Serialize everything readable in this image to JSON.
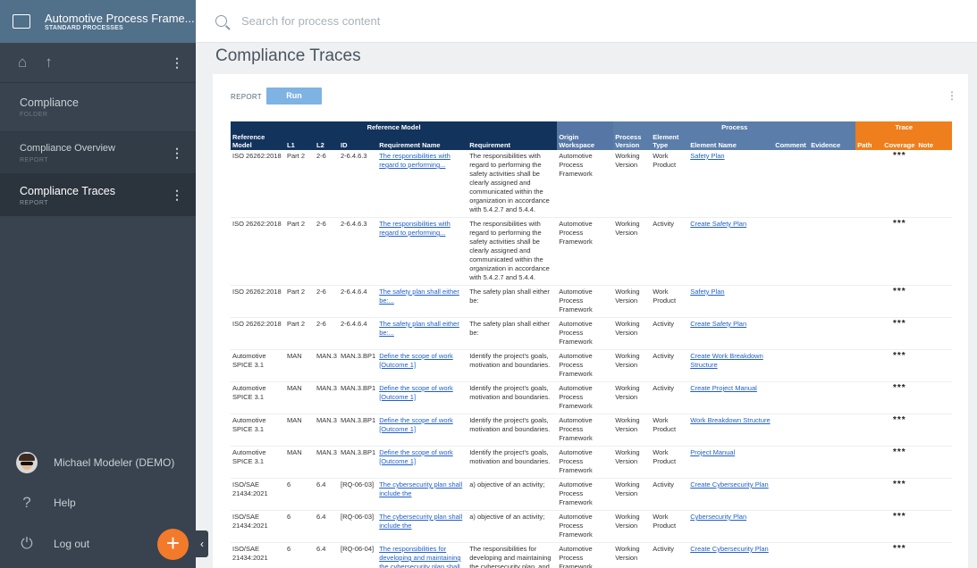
{
  "project": {
    "title": "Automotive Process Frame...",
    "subtitle": "STANDARD PROCESSES"
  },
  "sidebar": {
    "folder": {
      "title": "Compliance",
      "type": "FOLDER"
    },
    "items": [
      {
        "title": "Compliance Overview",
        "type": "REPORT"
      },
      {
        "title": "Compliance Traces",
        "type": "REPORT"
      }
    ],
    "user": "Michael Modeler (DEMO)",
    "help": "Help",
    "logout": "Log out"
  },
  "search": {
    "placeholder": "Search for process content"
  },
  "page": {
    "title": "Compliance Traces"
  },
  "report": {
    "label": "REPORT",
    "run": "Run"
  },
  "table": {
    "groups": {
      "reference_model": "Reference Model",
      "process": "Process",
      "trace": "Trace"
    },
    "headers": {
      "ref_model": "Reference Model",
      "l1": "L1",
      "l2": "L2",
      "id": "ID",
      "req_name": "Requirement Name",
      "req": "Requirement",
      "origin": "Origin Workspace",
      "version": "Process Version",
      "etype": "Element Type",
      "ename": "Element Name",
      "comment": "Comment",
      "evidence": "Evidence",
      "path": "Path",
      "coverage": "Coverage",
      "note": "Note"
    },
    "rows": [
      {
        "ref": "ISO 26262:2018",
        "l1": "Part 2",
        "l2": "2-6",
        "id": "2-6.4.6.3",
        "req_name": "The responsibilities with regard to performing...",
        "req": "The responsibilities with regard to performing the safety activities shall be clearly assigned and communicated within the organization in accordance with 5.4.2.7 and 5.4.4.",
        "origin": "Automotive Process Framework",
        "version": "Working Version",
        "etype": "Work Product",
        "ename": "Safety Plan",
        "cov": "***"
      },
      {
        "ref": "ISO 26262:2018",
        "l1": "Part 2",
        "l2": "2-6",
        "id": "2-6.4.6.3",
        "req_name": "The responsibilities with regard to performing...",
        "req": "The responsibilities with regard to performing the safety activities shall be clearly assigned and communicated within the organization in accordance with 5.4.2.7 and 5.4.4.",
        "origin": "Automotive Process Framework",
        "version": "Working Version",
        "etype": "Activity",
        "ename": "Create Safety Plan",
        "cov": "***"
      },
      {
        "ref": "ISO 26262:2018",
        "l1": "Part 2",
        "l2": "2-6",
        "id": "2-6.4.6.4",
        "req_name": "The safety plan shall either be:...",
        "req": "The safety plan shall either be:",
        "origin": "Automotive Process Framework",
        "version": "Working Version",
        "etype": "Work Product",
        "ename": "Safety Plan",
        "cov": "***"
      },
      {
        "ref": "ISO 26262:2018",
        "l1": "Part 2",
        "l2": "2-6",
        "id": "2-6.4.6.4",
        "req_name": "The safety plan shall either be:...",
        "req": "The safety plan shall either be:",
        "origin": "Automotive Process Framework",
        "version": "Working Version",
        "etype": "Activity",
        "ename": "Create Safety Plan",
        "cov": "***"
      },
      {
        "ref": "Automotive SPICE 3.1",
        "l1": "MAN",
        "l2": "MAN.3",
        "id": "MAN.3.BP1",
        "req_name": "Define the scope of work [Outcome 1]",
        "req": "Identify the project's goals, motivation and boundaries.",
        "origin": "Automotive Process Framework",
        "version": "Working Version",
        "etype": "Activity",
        "ename": "Create Work Breakdown Structure",
        "cov": "***"
      },
      {
        "ref": "Automotive SPICE 3.1",
        "l1": "MAN",
        "l2": "MAN.3",
        "id": "MAN.3.BP1",
        "req_name": "Define the scope of work [Outcome 1]",
        "req": "Identify the project's goals, motivation and boundaries.",
        "origin": "Automotive Process Framework",
        "version": "Working Version",
        "etype": "Activity",
        "ename": "Create Project Manual",
        "cov": "***"
      },
      {
        "ref": "Automotive SPICE 3.1",
        "l1": "MAN",
        "l2": "MAN.3",
        "id": "MAN.3.BP1",
        "req_name": "Define the scope of work [Outcome 1]",
        "req": "Identify the project's goals, motivation and boundaries.",
        "origin": "Automotive Process Framework",
        "version": "Working Version",
        "etype": "Work Product",
        "ename": "Work Breakdown Structure",
        "cov": "***"
      },
      {
        "ref": "Automotive SPICE 3.1",
        "l1": "MAN",
        "l2": "MAN.3",
        "id": "MAN.3.BP1",
        "req_name": "Define the scope of work [Outcome 1]",
        "req": "Identify the project's goals, motivation and boundaries.",
        "origin": "Automotive Process Framework",
        "version": "Working Version",
        "etype": "Work Product",
        "ename": "Project Manual",
        "cov": "***"
      },
      {
        "ref": "ISO/SAE 21434:2021",
        "l1": "6",
        "l2": "6.4",
        "id": "[RQ-06-03]",
        "req_name": "The cybersecurity plan shall include the",
        "req": "a) objective of an activity;",
        "origin": "Automotive Process Framework",
        "version": "Working Version",
        "etype": "Activity",
        "ename": "Create Cybersecurity Plan",
        "cov": "***"
      },
      {
        "ref": "ISO/SAE 21434:2021",
        "l1": "6",
        "l2": "6.4",
        "id": "[RQ-06-03]",
        "req_name": "The cybersecurity plan shall include the",
        "req": "a) objective of an activity;",
        "origin": "Automotive Process Framework",
        "version": "Working Version",
        "etype": "Work Product",
        "ename": "Cybersecurity Plan",
        "cov": "***"
      },
      {
        "ref": "ISO/SAE 21434:2021",
        "l1": "6",
        "l2": "6.4",
        "id": "[RQ-06-04]",
        "req_name": "The responsibilities for developing and maintaining the cybersecurity plan shall be assigned",
        "req": "The responsibilities for developing and maintaining the cybersecurity plan, and for tracking the progress of",
        "origin": "Automotive Process Framework",
        "version": "Working Version",
        "etype": "Activity",
        "ename": "Create Cybersecurity Plan",
        "cov": "***"
      }
    ]
  }
}
